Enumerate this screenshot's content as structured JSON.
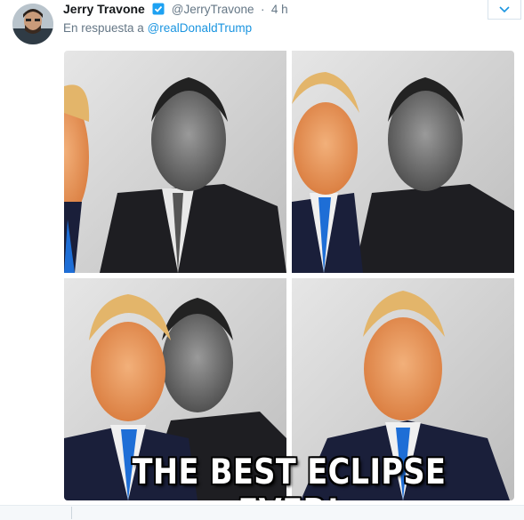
{
  "tweet": {
    "author_name": "Jerry Travone",
    "author_handle": "@JerryTravone",
    "separator": "·",
    "time_ago": "4 h",
    "reply_prefix": "En respuesta a",
    "reply_to": "@realDonaldTrump",
    "verified_icon": "verified-badge-icon",
    "menu_icon": "chevron-down-icon",
    "accent_color": "#1b95e0",
    "media": {
      "caption": "THE BEST ECLIPSE EVER!",
      "panel_count": 4
    }
  }
}
